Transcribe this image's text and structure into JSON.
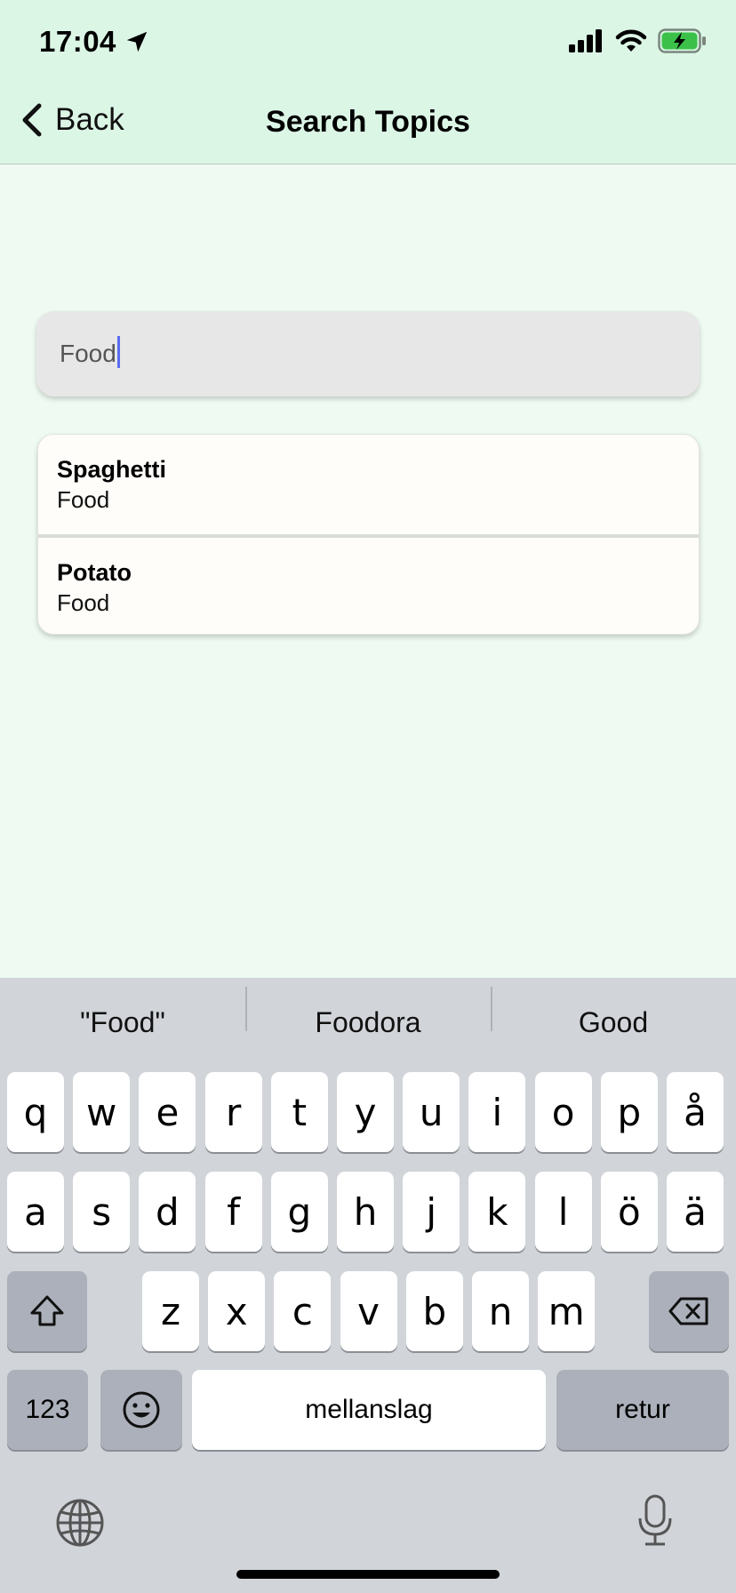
{
  "status_bar": {
    "time": "17:04",
    "icons": [
      "location-arrow-icon",
      "signal-icon",
      "wifi-icon",
      "battery-charging-icon"
    ],
    "battery_color": "#3bc14a"
  },
  "nav": {
    "back_label": "Back",
    "title": "Search Topics"
  },
  "search": {
    "value": "Food"
  },
  "results": [
    {
      "title": "Spaghetti",
      "subtitle": "Food"
    },
    {
      "title": "Potato",
      "subtitle": "Food"
    }
  ],
  "keyboard": {
    "suggestions": [
      "\"Food\"",
      "Foodora",
      "Good"
    ],
    "row1": [
      "q",
      "w",
      "e",
      "r",
      "t",
      "y",
      "u",
      "i",
      "o",
      "p",
      "å"
    ],
    "row2": [
      "a",
      "s",
      "d",
      "f",
      "g",
      "h",
      "j",
      "k",
      "l",
      "ö",
      "ä"
    ],
    "row3": [
      "z",
      "x",
      "c",
      "v",
      "b",
      "n",
      "m"
    ],
    "numbers_label": "123",
    "space_label": "mellanslag",
    "return_label": "retur"
  }
}
